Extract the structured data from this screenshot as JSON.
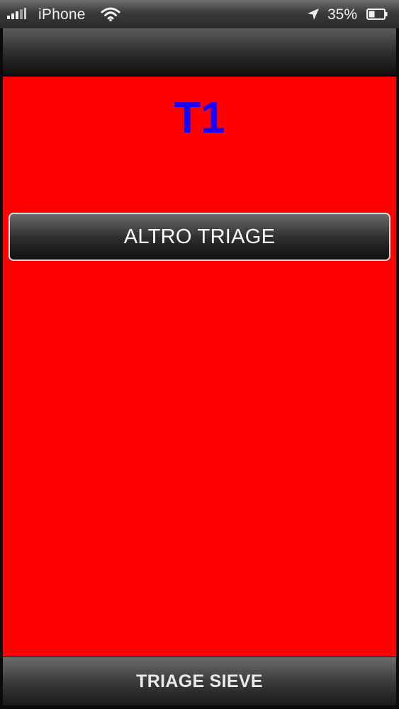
{
  "status_bar": {
    "carrier": "iPhone",
    "battery_percent": "35%",
    "icons": [
      "signal-icon",
      "wifi-icon",
      "location-arrow-icon",
      "battery-icon"
    ]
  },
  "main": {
    "triage_code": "T1",
    "triage_code_color": "#1a00ff",
    "background_color": "#ff0000",
    "altro_button_label": "ALTRO TRIAGE"
  },
  "bottom_bar": {
    "tab_label": "TRIAGE SIEVE"
  }
}
